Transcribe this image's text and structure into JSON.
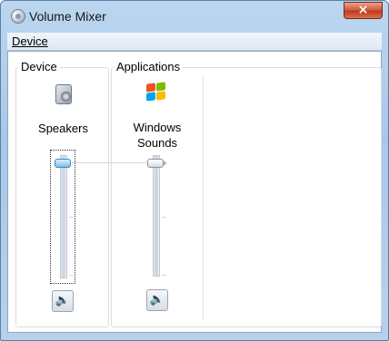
{
  "window": {
    "title": "Volume Mixer",
    "close_glyph": "×",
    "app_icon": "volume-mixer-icon"
  },
  "menu": {
    "device_label": "Device"
  },
  "groups": {
    "device_label": "Device",
    "applications_label": "Applications"
  },
  "device": {
    "name": "Speakers",
    "icon": "speaker-icon",
    "volume_level": 1.0,
    "mute_icon": "speaker-volume-icon",
    "mute_glyph": "🔈"
  },
  "applications": [
    {
      "name_line1": "Windows",
      "name_line2": "Sounds",
      "icon": "windows-logo-icon",
      "volume_level": 1.0,
      "mute_icon": "speaker-volume-icon",
      "mute_glyph": "🔈"
    }
  ],
  "colors": {
    "titlebar": "#a9c8e8",
    "close_button": "#c1391a",
    "master_thumb": "#7fbfe8"
  }
}
